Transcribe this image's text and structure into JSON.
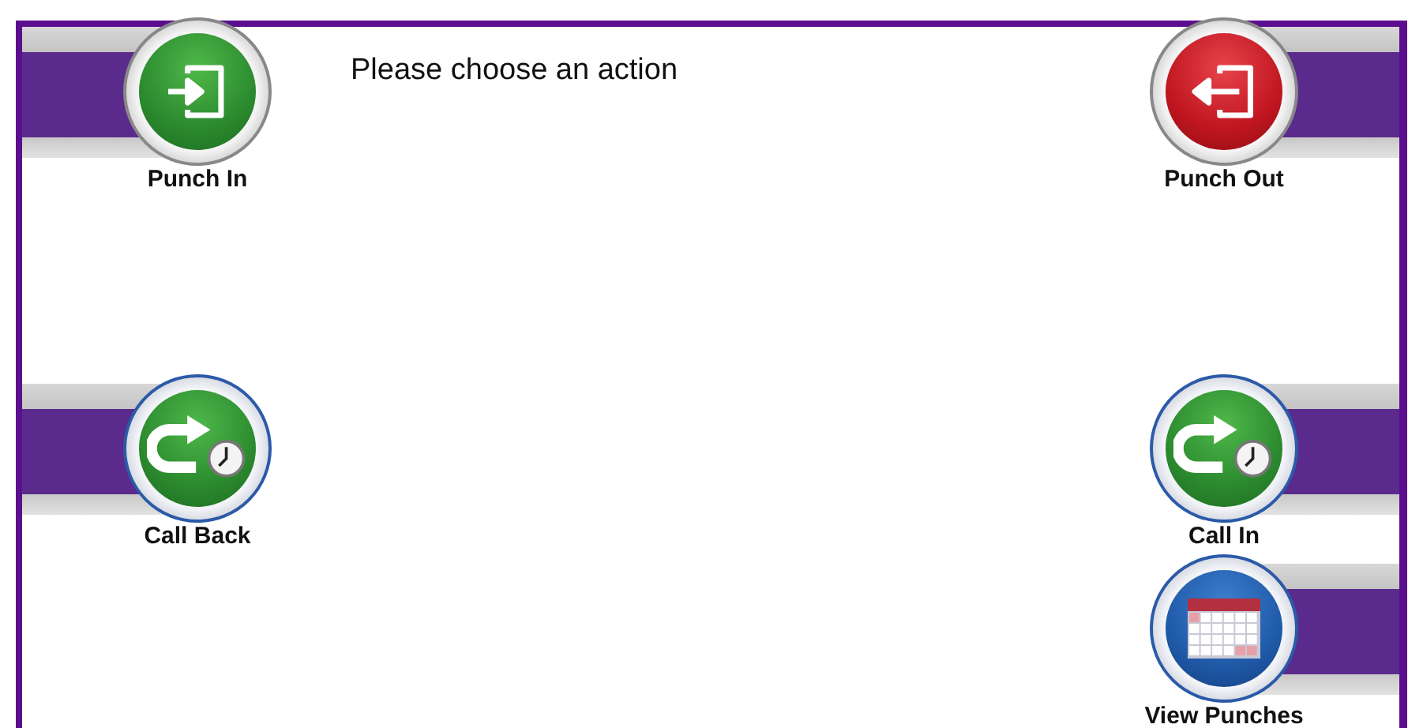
{
  "prompt": "Please choose an action",
  "left_actions": [
    {
      "label": "Punch In",
      "kind": "enter"
    },
    {
      "label": "Call Back",
      "kind": "callback"
    }
  ],
  "right_actions": [
    {
      "label": "Punch Out",
      "kind": "exit"
    },
    {
      "label": "Call In",
      "kind": "callback"
    },
    {
      "label": "View Punches",
      "kind": "calendar"
    }
  ]
}
